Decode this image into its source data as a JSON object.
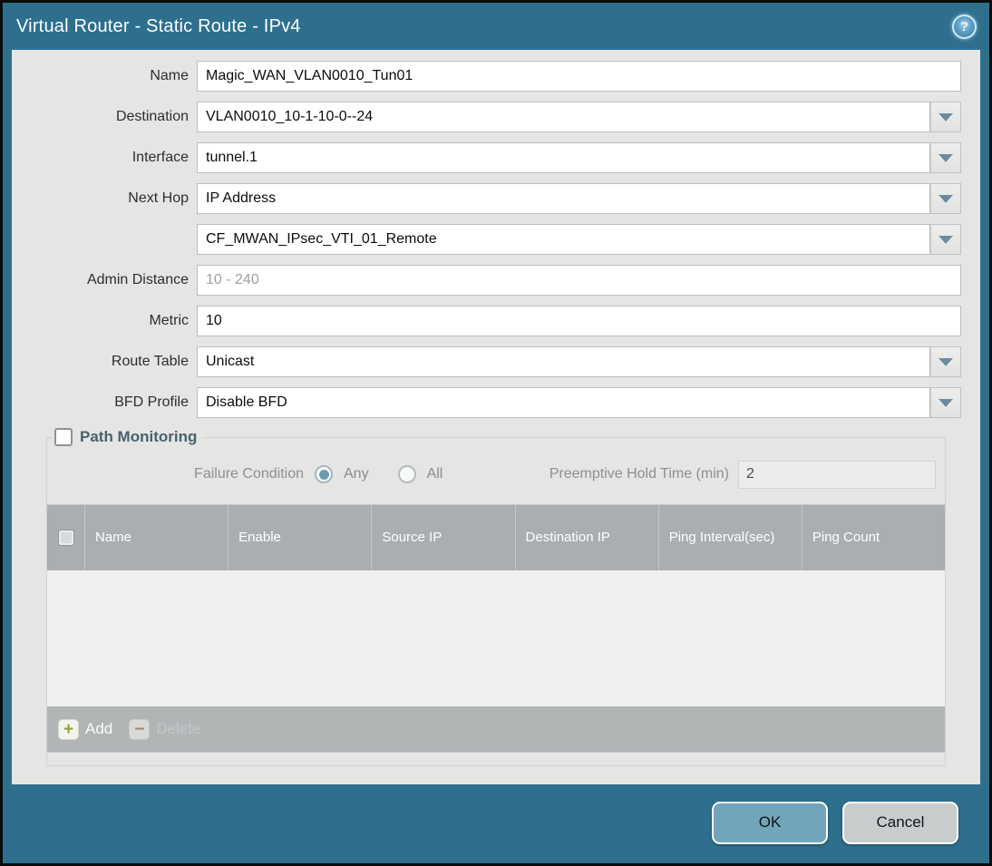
{
  "window": {
    "title": "Virtual Router - Static Route - IPv4"
  },
  "icons": {
    "help": "?",
    "dropdown": "chevron-down",
    "add": "+",
    "delete": "−"
  },
  "form": {
    "name": {
      "label": "Name",
      "value": "Magic_WAN_VLAN0010_Tun01"
    },
    "destination": {
      "label": "Destination",
      "value": "VLAN0010_10-1-10-0--24"
    },
    "interface": {
      "label": "Interface",
      "value": "tunnel.1"
    },
    "next_hop": {
      "label": "Next Hop",
      "value": "IP Address"
    },
    "next_hop_address": {
      "value": "CF_MWAN_IPsec_VTI_01_Remote"
    },
    "admin_distance": {
      "label": "Admin Distance",
      "value": "",
      "placeholder": "10 - 240"
    },
    "metric": {
      "label": "Metric",
      "value": "10"
    },
    "route_table": {
      "label": "Route Table",
      "value": "Unicast"
    },
    "bfd_profile": {
      "label": "BFD Profile",
      "value": "Disable BFD"
    }
  },
  "path_monitoring": {
    "title": "Path Monitoring",
    "enabled": false,
    "failure_condition_label": "Failure Condition",
    "options": [
      {
        "label": "Any",
        "selected": true
      },
      {
        "label": "All",
        "selected": false
      }
    ],
    "preemptive_hold_label": "Preemptive Hold Time (min)",
    "preemptive_hold_value": "2",
    "table": {
      "columns": [
        "Name",
        "Enable",
        "Source IP",
        "Destination IP",
        "Ping Interval(sec)",
        "Ping Count"
      ],
      "rows": [],
      "add_label": "Add",
      "delete_label": "Delete"
    }
  },
  "footer": {
    "ok_label": "OK",
    "cancel_label": "Cancel"
  },
  "colors": {
    "frame_teal": "#2e6f8e",
    "panel_gray": "#e5e5e4",
    "table_header_gray": "#aaaeb0",
    "ok_button": "#73a5ba",
    "cancel_button": "#c9cccd",
    "radio_selected_dot": "#6e9cb1",
    "add_icon_green": "#8ca33c",
    "delete_icon_red": "#a8705f"
  }
}
